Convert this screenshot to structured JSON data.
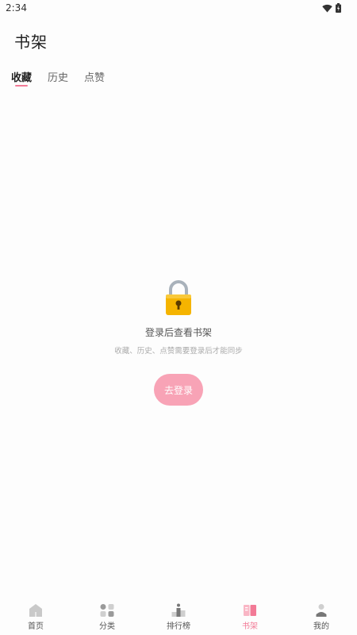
{
  "status": {
    "time": "2:34"
  },
  "header": {
    "title": "书架"
  },
  "tabs": [
    {
      "label": "收藏",
      "active": true
    },
    {
      "label": "历史",
      "active": false
    },
    {
      "label": "点赞",
      "active": false
    }
  ],
  "empty": {
    "icon": "lock-icon",
    "title": "登录后查看书架",
    "subtitle": "收藏、历史、点赞需要登录后才能同步",
    "login_label": "去登录"
  },
  "nav": [
    {
      "label": "首页",
      "icon": "home-icon"
    },
    {
      "label": "分类",
      "icon": "category-icon"
    },
    {
      "label": "排行榜",
      "icon": "ranking-icon"
    },
    {
      "label": "书架",
      "icon": "bookshelf-icon",
      "active": true
    },
    {
      "label": "我的",
      "icon": "profile-icon"
    }
  ],
  "colors": {
    "accent": "#f27a96",
    "button": "#f8a3b6"
  }
}
